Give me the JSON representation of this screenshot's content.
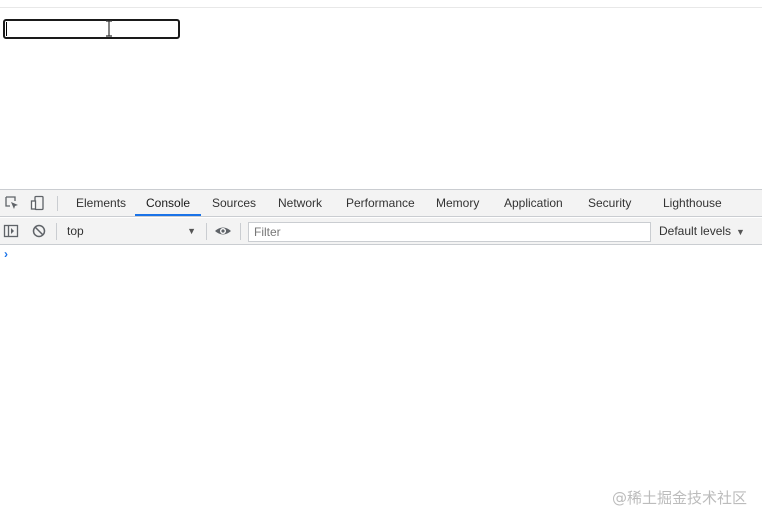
{
  "page": {
    "input_value": ""
  },
  "devtools": {
    "tabs": [
      {
        "label": "Elements"
      },
      {
        "label": "Console"
      },
      {
        "label": "Sources"
      },
      {
        "label": "Network"
      },
      {
        "label": "Performance"
      },
      {
        "label": "Memory"
      },
      {
        "label": "Application"
      },
      {
        "label": "Security"
      },
      {
        "label": "Lighthouse"
      }
    ],
    "active_tab": "Console",
    "toolbar": {
      "context": "top",
      "filter_placeholder": "Filter",
      "levels_label": "Default levels"
    },
    "console": {
      "prompt_symbol": "›"
    },
    "colors": {
      "accent": "#1a73e8",
      "toolbar_bg": "#f3f3f3",
      "border": "#cacdd1"
    }
  },
  "watermark": "@稀土掘金技术社区"
}
